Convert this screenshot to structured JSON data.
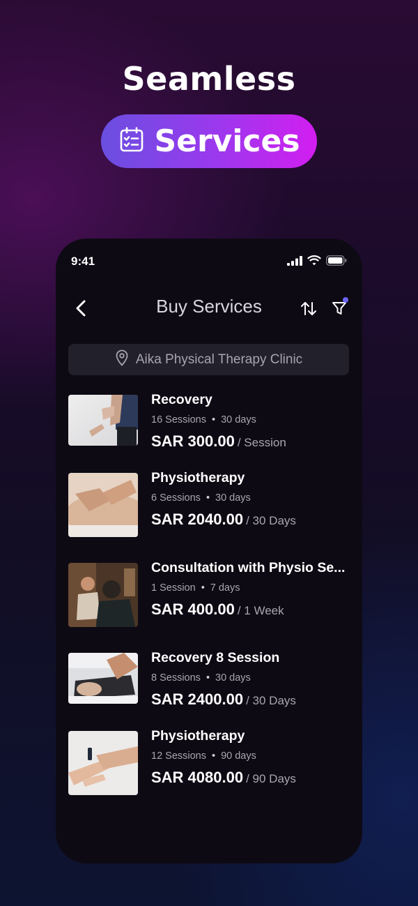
{
  "hero": {
    "title": "Seamless",
    "pill_label": "Services"
  },
  "status_bar": {
    "time": "9:41"
  },
  "header": {
    "title": "Buy Services"
  },
  "location": {
    "name": "Aika Physical Therapy Clinic"
  },
  "services": [
    {
      "name": "Recovery",
      "sessions": "16 Sessions",
      "duration": "30 days",
      "price": "SAR 300.00",
      "unit": "/ Session"
    },
    {
      "name": "Physiotherapy",
      "sessions": "6 Sessions",
      "duration": "30 days",
      "price": "SAR 2040.00",
      "unit": "/ 30 Days"
    },
    {
      "name": "Consultation with Physio Se...",
      "sessions": "1 Session",
      "duration": "7 days",
      "price": "SAR 400.00",
      "unit": "/ 1 Week"
    },
    {
      "name": "Recovery 8 Session",
      "sessions": "8 Sessions",
      "duration": "30 days",
      "price": "SAR 2400.00",
      "unit": "/ 30 Days"
    },
    {
      "name": "Physiotherapy",
      "sessions": "12 Sessions",
      "duration": "90 days",
      "price": "SAR 4080.00",
      "unit": "/ 90 Days"
    }
  ],
  "colors": {
    "accent_start": "#6a4fe0",
    "accent_end": "#d21ef0",
    "filter_dot": "#6a64f0"
  },
  "icons": [
    "checklist-icon",
    "signal-icon",
    "wifi-icon",
    "battery-icon",
    "back-icon",
    "sort-icon",
    "filter-icon",
    "location-pin-icon"
  ]
}
